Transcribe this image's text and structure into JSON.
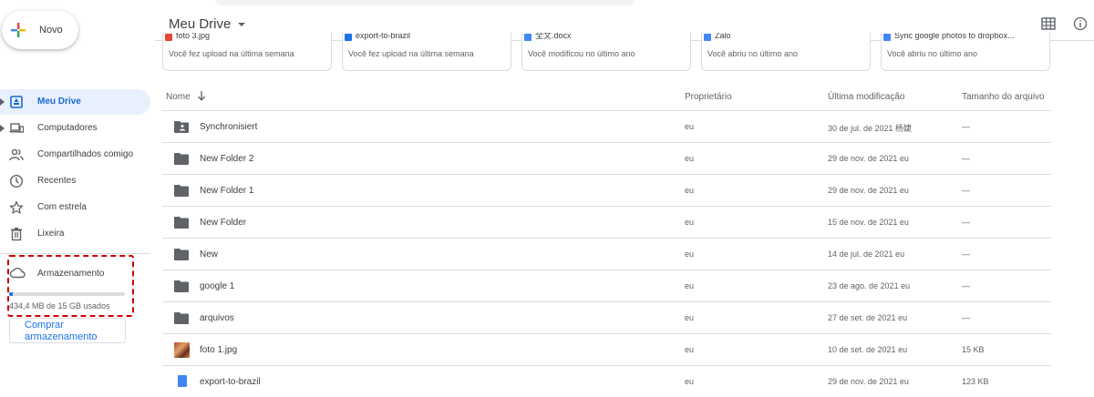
{
  "header": {
    "title": "Meu Drive"
  },
  "sidebar": {
    "new_label": "Novo",
    "items": [
      {
        "label": "Meu Drive",
        "icon": "drive-icon",
        "active": true,
        "caret": true
      },
      {
        "label": "Computadores",
        "icon": "computer-icon",
        "active": false,
        "caret": true
      },
      {
        "label": "Compartilhados comigo",
        "icon": "people-icon",
        "active": false,
        "caret": false
      },
      {
        "label": "Recentes",
        "icon": "clock-icon",
        "active": false,
        "caret": false
      },
      {
        "label": "Com estrela",
        "icon": "star-icon",
        "active": false,
        "caret": false
      },
      {
        "label": "Lixeira",
        "icon": "trash-icon",
        "active": false,
        "caret": false
      }
    ],
    "storage": {
      "label": "Armazenamento",
      "usage_text": "434,4 MB de 15 GB usados",
      "used_fraction": 0.029,
      "buy_label": "Comprar armazenamento"
    }
  },
  "quick_access": [
    {
      "title": "foto 3.jpg",
      "subtitle": "Você fez upload na última semana",
      "icon_color": "#ea4335"
    },
    {
      "title": "export-to-brazil",
      "subtitle": "Você fez upload na última semana",
      "icon_color": "#1a73e8"
    },
    {
      "title": "全文.docx",
      "subtitle": "Você modificou no último ano",
      "icon_color": "#4285f4"
    },
    {
      "title": "Zalo",
      "subtitle": "Você abriu no último ano",
      "icon_color": "#4285f4"
    },
    {
      "title": "Sync google photos to dropbox...",
      "subtitle": "Você abriu no último ano",
      "icon_color": "#4285f4"
    }
  ],
  "list": {
    "columns": {
      "name": "Nome",
      "owner": "Proprietário",
      "modified": "Última modificação",
      "size": "Tamanho do arquivo"
    },
    "rows": [
      {
        "name": "Synchronisiert",
        "type": "shared-folder",
        "owner": "eu",
        "modified": "30 de jul. de 2021 杨婕",
        "size": "—"
      },
      {
        "name": "New Folder 2",
        "type": "folder",
        "owner": "eu",
        "modified": "29 de nov. de 2021 eu",
        "size": "—"
      },
      {
        "name": "New Folder 1",
        "type": "folder",
        "owner": "eu",
        "modified": "29 de nov. de 2021 eu",
        "size": "—"
      },
      {
        "name": "New Folder",
        "type": "folder",
        "owner": "eu",
        "modified": "15 de nov. de 2021 eu",
        "size": "—"
      },
      {
        "name": "New",
        "type": "folder",
        "owner": "eu",
        "modified": "14 de jul. de 2021 eu",
        "size": "—"
      },
      {
        "name": "google 1",
        "type": "folder",
        "owner": "eu",
        "modified": "23 de ago. de 2021 eu",
        "size": "—"
      },
      {
        "name": "arquivos",
        "type": "folder",
        "owner": "eu",
        "modified": "27 de set. de 2021 eu",
        "size": "—"
      },
      {
        "name": "foto 1.jpg",
        "type": "image",
        "owner": "eu",
        "modified": "10 de set. de 2021 eu",
        "size": "15 KB"
      },
      {
        "name": "export-to-brazil",
        "type": "doc",
        "owner": "eu",
        "modified": "29 de nov. de 2021 eu",
        "size": "123 KB"
      }
    ]
  },
  "colors": {
    "accent": "#1a73e8",
    "active_bg": "#e8f0fe",
    "highlight_box": "#cc0000"
  }
}
